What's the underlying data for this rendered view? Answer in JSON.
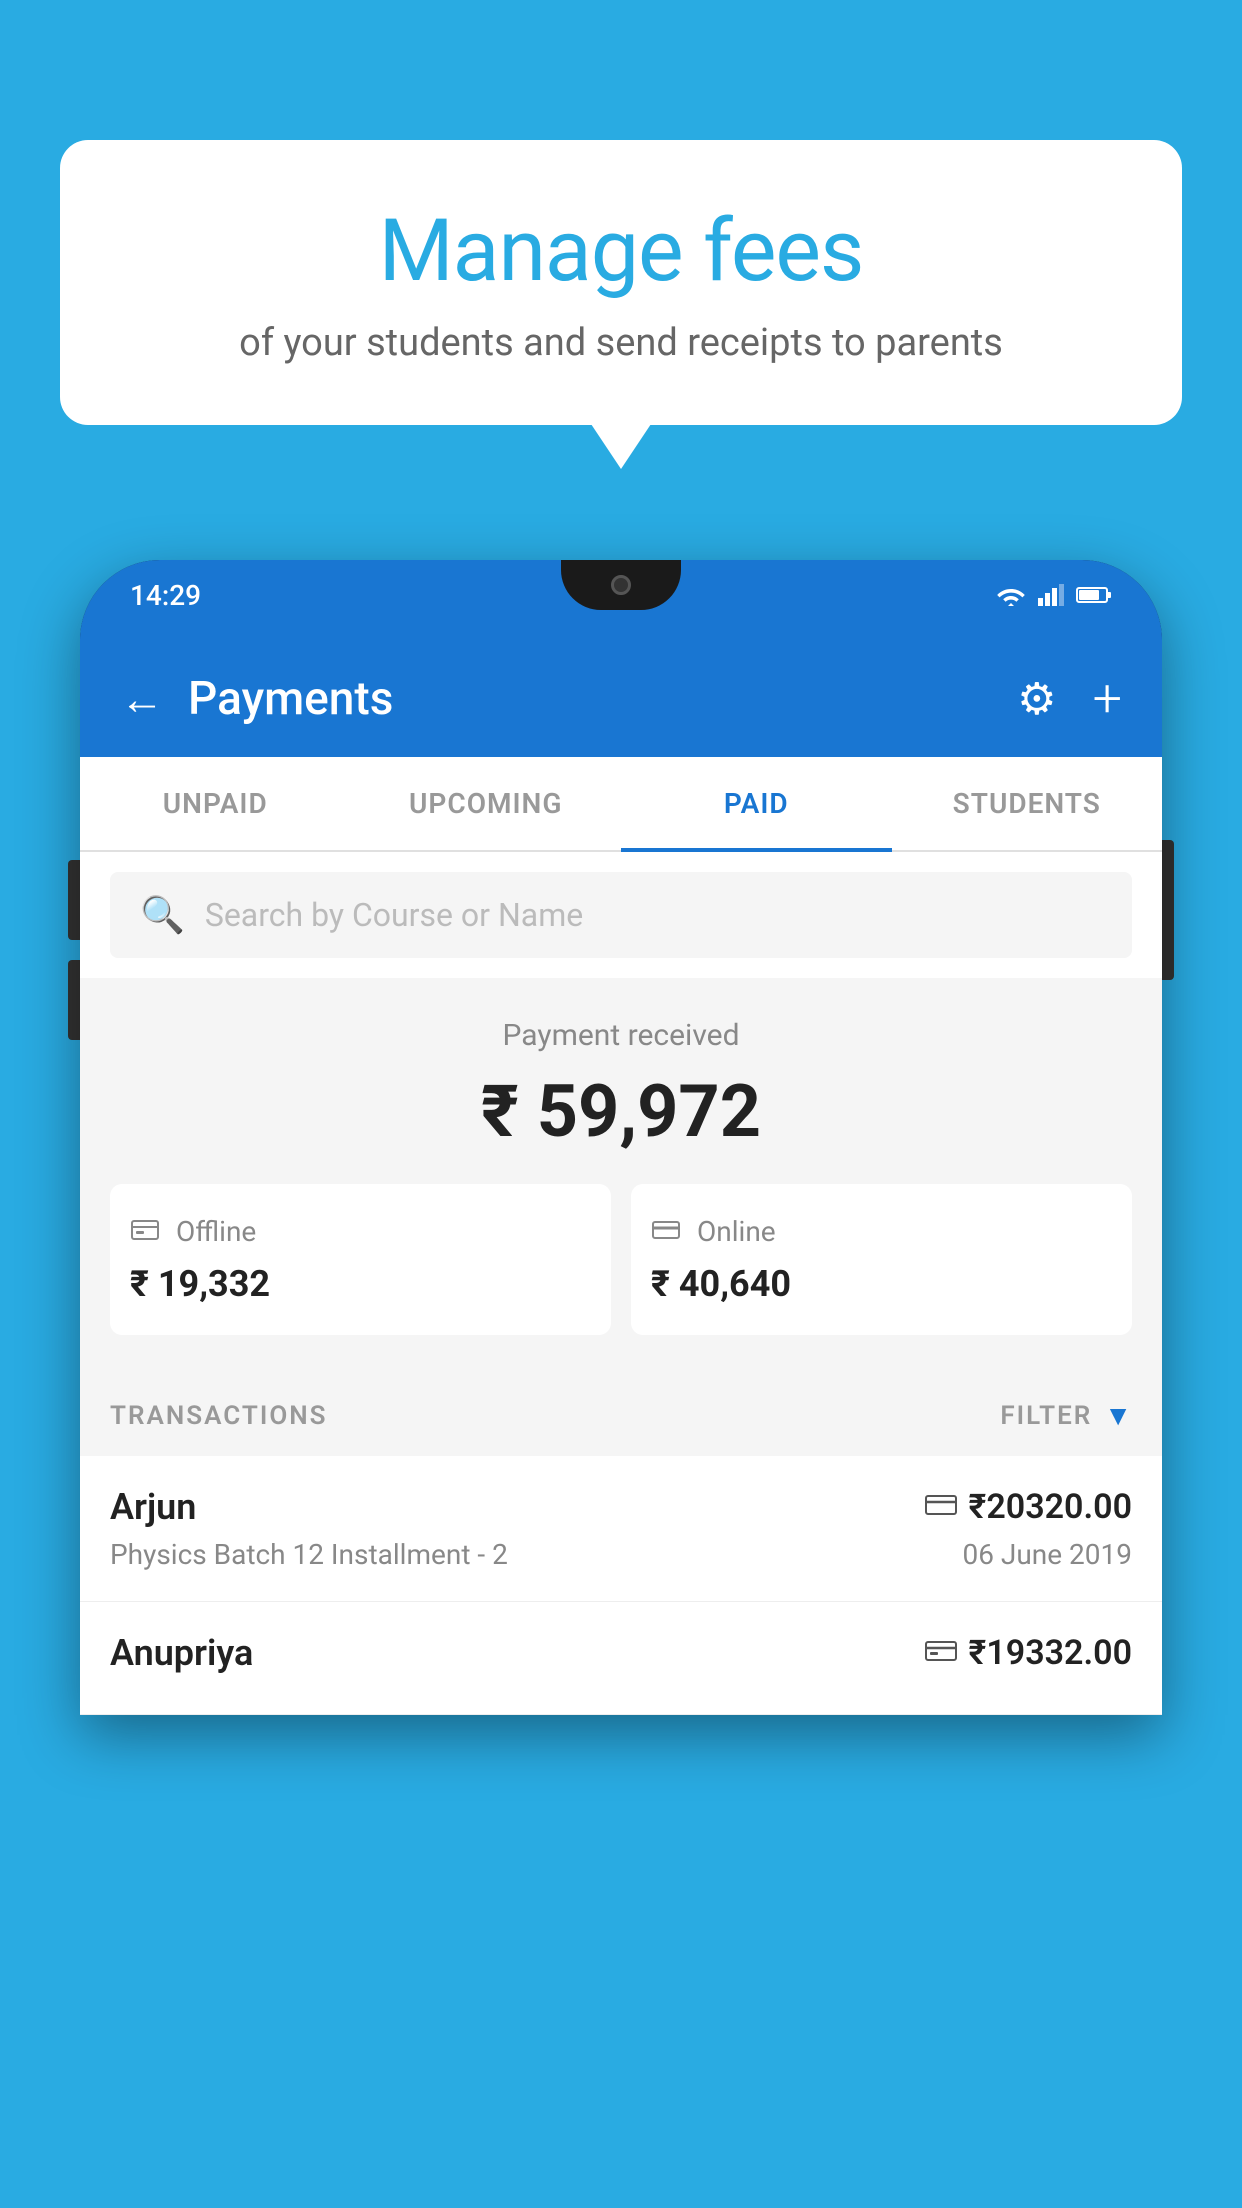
{
  "background_color": "#29ABE2",
  "speech_bubble": {
    "title": "Manage fees",
    "subtitle": "of your students and send receipts to parents"
  },
  "status_bar": {
    "time": "14:29"
  },
  "app_header": {
    "title": "Payments",
    "back_label": "←",
    "settings_label": "⚙",
    "add_label": "+"
  },
  "tabs": [
    {
      "label": "UNPAID",
      "active": false
    },
    {
      "label": "UPCOMING",
      "active": false
    },
    {
      "label": "PAID",
      "active": true
    },
    {
      "label": "STUDENTS",
      "active": false
    }
  ],
  "search": {
    "placeholder": "Search by Course or Name"
  },
  "payment_summary": {
    "label": "Payment received",
    "total": "₹ 59,972",
    "offline": {
      "label": "Offline",
      "amount": "₹ 19,332"
    },
    "online": {
      "label": "Online",
      "amount": "₹ 40,640"
    }
  },
  "transactions_section": {
    "header_label": "TRANSACTIONS",
    "filter_label": "FILTER"
  },
  "transactions": [
    {
      "name": "Arjun",
      "course": "Physics Batch 12 Installment - 2",
      "amount": "₹20320.00",
      "date": "06 June 2019",
      "method": "card"
    },
    {
      "name": "Anupriya",
      "course": "",
      "amount": "₹19332.00",
      "date": "",
      "method": "offline"
    }
  ]
}
